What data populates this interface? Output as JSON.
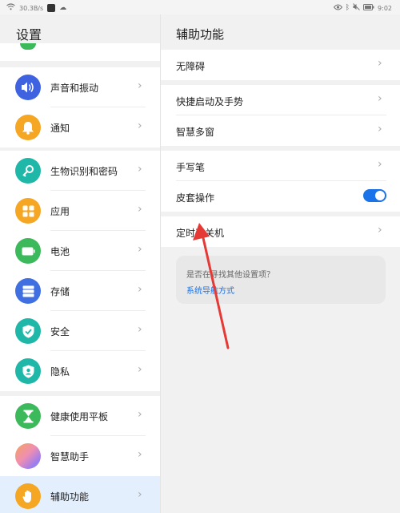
{
  "status_bar": {
    "net_speed": "30.3B/s",
    "time": "9:02"
  },
  "left": {
    "title": "设置",
    "items": [
      {
        "label": "声音和振动",
        "icon": "speaker-icon",
        "color": "#3f63e0"
      },
      {
        "label": "通知",
        "icon": "bell-icon",
        "color": "#f5a623"
      },
      {
        "label": "生物识别和密码",
        "icon": "key-icon",
        "color": "#1fb7a8"
      },
      {
        "label": "应用",
        "icon": "apps-grid-icon",
        "color": "#f5a623"
      },
      {
        "label": "电池",
        "icon": "battery-icon",
        "color": "#3cb95a"
      },
      {
        "label": "存储",
        "icon": "storage-icon",
        "color": "#3f6fe0"
      },
      {
        "label": "安全",
        "icon": "shield-check-icon",
        "color": "#1fb7a8"
      },
      {
        "label": "隐私",
        "icon": "privacy-icon",
        "color": "#1fb7a8"
      },
      {
        "label": "健康使用平板",
        "icon": "hourglass-icon",
        "color": "#3cb95a"
      },
      {
        "label": "智慧助手",
        "icon": "assistant-orb-icon",
        "color": "#f08fb0"
      },
      {
        "label": "辅助功能",
        "icon": "hand-icon",
        "color": "#f5a623"
      }
    ]
  },
  "right": {
    "title": "辅助功能",
    "items": [
      {
        "label": "无障碍"
      },
      {
        "label": "快捷启动及手势"
      },
      {
        "label": "智慧多窗"
      },
      {
        "label": "手写笔"
      },
      {
        "label": "皮套操作"
      },
      {
        "label": "定时开关机"
      }
    ],
    "toggle_on": true,
    "suggest": {
      "question": "是否在寻找其他设置项？",
      "link": "系统导航方式"
    }
  },
  "colors": {
    "accent": "#1a73e8",
    "annotation_arrow": "#e53935"
  }
}
